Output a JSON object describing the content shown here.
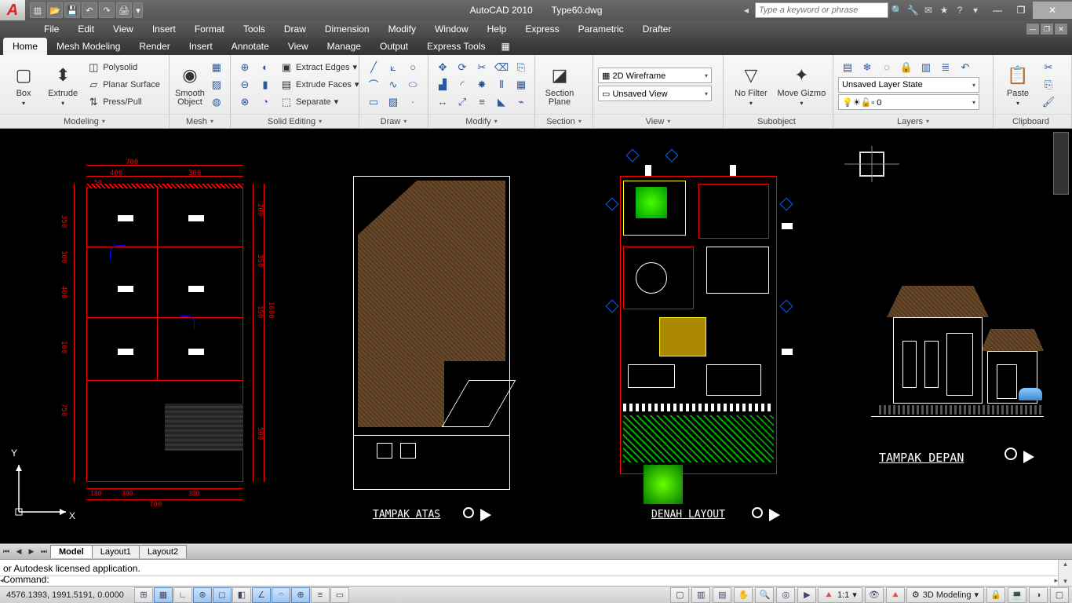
{
  "app": {
    "title1": "AutoCAD 2010",
    "title2": "Type60.dwg",
    "search_placeholder": "Type a keyword or phrase"
  },
  "menus": [
    "File",
    "Edit",
    "View",
    "Insert",
    "Format",
    "Tools",
    "Draw",
    "Dimension",
    "Modify",
    "Window",
    "Help",
    "Express",
    "Parametric",
    "Drafter"
  ],
  "ribbon_tabs": [
    "Home",
    "Mesh Modeling",
    "Render",
    "Insert",
    "Annotate",
    "View",
    "Manage",
    "Output",
    "Express Tools"
  ],
  "panels": {
    "modeling": {
      "title": "Modeling",
      "box": "Box",
      "extrude": "Extrude",
      "polysolid": "Polysolid",
      "planar": "Planar Surface",
      "presspull": "Press/Pull"
    },
    "mesh": {
      "title": "Mesh",
      "smooth": "Smooth Object"
    },
    "solid": {
      "title": "Solid Editing",
      "extract": "Extract Edges",
      "extrudefaces": "Extrude Faces",
      "separate": "Separate"
    },
    "draw": {
      "title": "Draw"
    },
    "modify": {
      "title": "Modify"
    },
    "section": {
      "title": "Section",
      "btn": "Section Plane"
    },
    "view": {
      "title": "View",
      "style": "2D Wireframe",
      "saved": "Unsaved View"
    },
    "subobject": {
      "title": "Subobject",
      "filter": "No Filter",
      "gizmo": "Move Gizmo"
    },
    "layers": {
      "title": "Layers",
      "state": "Unsaved Layer State",
      "current": "0"
    },
    "clipboard": {
      "title": "Clipboard",
      "paste": "Paste"
    }
  },
  "drawing": {
    "labels": {
      "tampak_atas": "TAMPAK ATAS",
      "denah": "DENAH LAYOUT",
      "tampak_depan": "TAMPAK DEPAN"
    },
    "dims": {
      "d700a": "700",
      "d400": "400",
      "d300": "300",
      "d50": "50",
      "d350a": "350",
      "d100a": "100",
      "d400b": "400",
      "d100b": "100",
      "d750": "750",
      "d100c": "100",
      "d300b": "300",
      "d300c": "300",
      "d700b": "700",
      "d200": "200",
      "d350b": "350",
      "d150": "150",
      "d1600": "1600",
      "d500": "500"
    },
    "ucs": {
      "x": "X",
      "y": "Y"
    }
  },
  "layout_tabs": [
    "Model",
    "Layout1",
    "Layout2"
  ],
  "cmd": {
    "history": "or Autodesk licensed application.",
    "prompt": "Command:"
  },
  "status": {
    "coords": "4576.1393, 1991.5191, 0.0000",
    "scale": "1:1",
    "workspace": "3D Modeling"
  }
}
